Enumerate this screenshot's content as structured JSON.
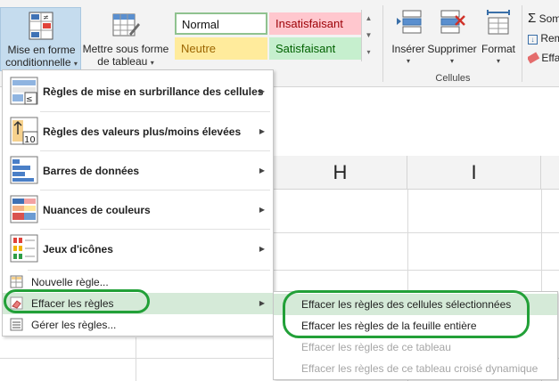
{
  "ribbon": {
    "conditional_format": {
      "line1": "Mise en forme",
      "line2": "conditionnelle",
      "caret": "▾",
      "icon": "conditional-formatting-icon"
    },
    "format_as_table": {
      "line1": "Mettre sous forme",
      "line2": "de tableau",
      "caret": "▾",
      "icon": "table-format-icon"
    },
    "styles": {
      "normal": "Normal",
      "insatisfaisant": "Insatisfaisant",
      "neutre": "Neutre",
      "satisfaisant": "Satisfaisant"
    },
    "cells": {
      "insert": {
        "label": "Insérer",
        "caret": "▾",
        "icon": "insert-cells-icon"
      },
      "delete": {
        "label": "Supprimer",
        "caret": "▾",
        "icon": "delete-cells-icon"
      },
      "format": {
        "label": "Format",
        "caret": "▾",
        "icon": "format-cells-icon"
      },
      "group_label": "Cellules"
    },
    "editing": {
      "sum": "Som",
      "fill": "Rem",
      "clear": "Effa"
    }
  },
  "sheet": {
    "columns": [
      "H",
      "I"
    ]
  },
  "menu": {
    "items_big": [
      {
        "label": "Règles de mise en surbrillance des cellules",
        "icon": "highlight-rules-icon"
      },
      {
        "label": "Règles des valeurs plus/moins élevées",
        "icon": "top-bottom-rules-icon"
      },
      {
        "label": "Barres de données",
        "icon": "data-bars-icon"
      },
      {
        "label": "Nuances de couleurs",
        "icon": "color-scales-icon"
      },
      {
        "label": "Jeux d'icônes",
        "icon": "icon-sets-icon"
      }
    ],
    "new_rule": "Nouvelle règle...",
    "clear_rules": "Effacer les règles",
    "manage_rules": "Gérer les règles...",
    "arrow": "▶"
  },
  "submenu": {
    "items": [
      "Effacer les règles  des cellules sélectionnées",
      "Effacer les règles de la feuille entière",
      "Effacer les règles  de ce tableau",
      "Effacer les règles  de ce tableau croisé dynamique"
    ]
  },
  "colors": {
    "highlight": "#d5ead8",
    "annotation_ring": "#22a038",
    "accent": "#217346"
  }
}
